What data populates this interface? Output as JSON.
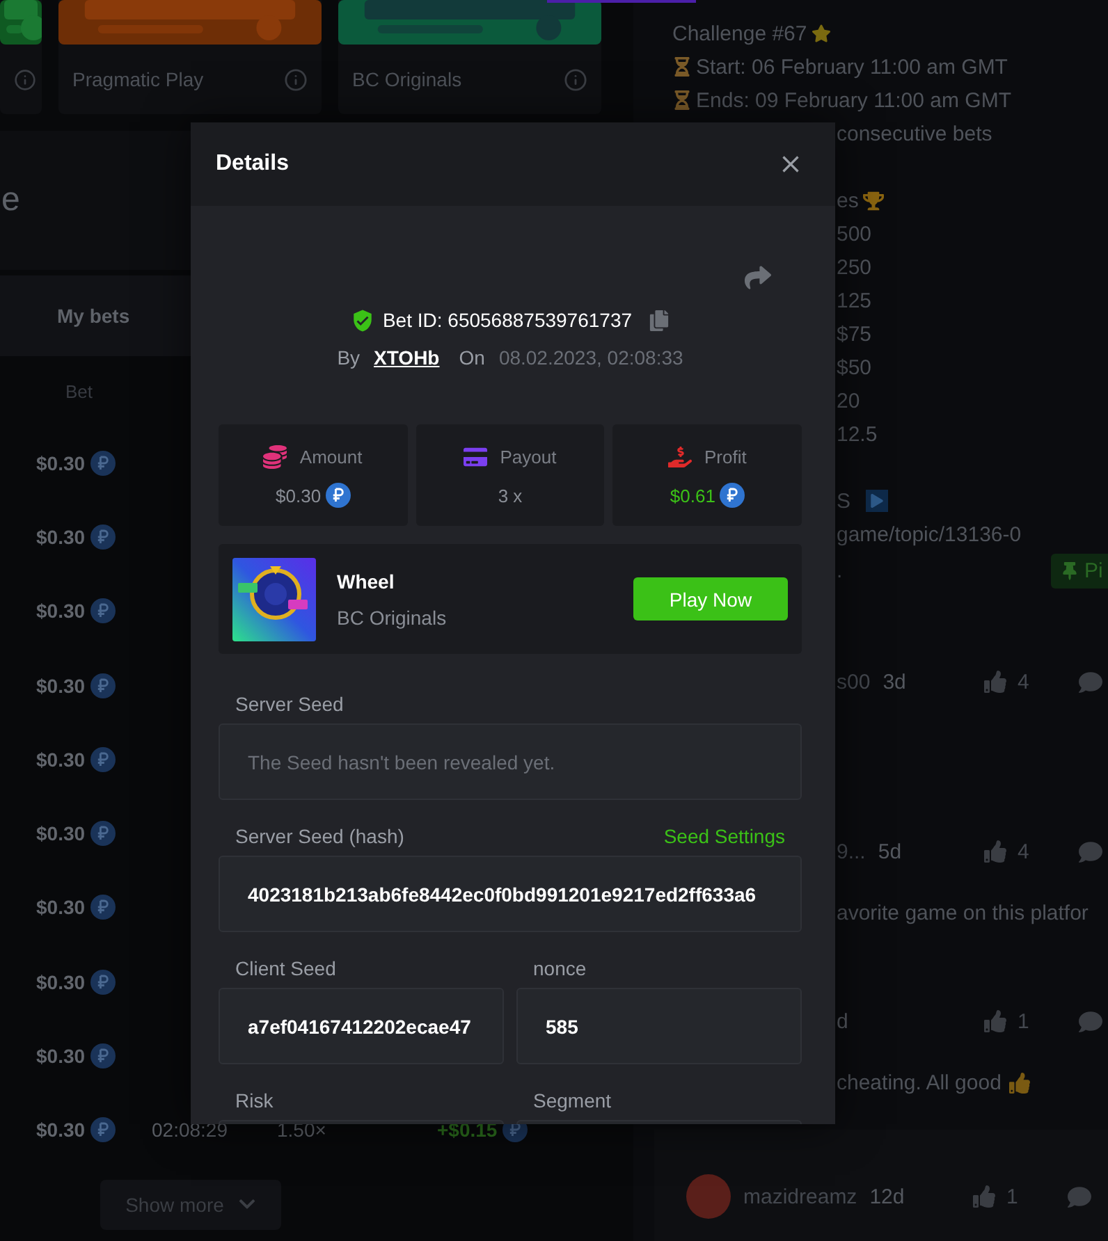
{
  "game_cards": [
    {
      "kind": "partial"
    },
    {
      "kind": "full",
      "provider": "Pragmatic Play"
    },
    {
      "kind": "full",
      "provider": "BC Originals"
    }
  ],
  "heading": "e",
  "tabs": [
    {
      "label": "My bets",
      "selected": true
    }
  ],
  "bets_table": {
    "columns": [
      "Bet"
    ],
    "rows": [
      {
        "bet": "$0.30"
      },
      {
        "bet": "$0.30"
      },
      {
        "bet": "$0.30"
      },
      {
        "bet": "$0.30"
      },
      {
        "bet": "$0.30"
      },
      {
        "bet": "$0.30"
      },
      {
        "bet": "$0.30"
      },
      {
        "bet": "$0.30"
      },
      {
        "bet": "$0.30"
      },
      {
        "bet": "$0.30",
        "time": "02:08:29",
        "payout": "1.50×",
        "profit": "+$0.15"
      }
    ]
  },
  "show_more": "Show more",
  "challenge": [
    {
      "text": "Challenge #67",
      "kind": "line",
      "star": true
    },
    {
      "text": "Start: 06 February 11:00 am GMT",
      "kind": "line",
      "hourglass": true
    },
    {
      "text": "Ends: 09 February 11:00 am GMT",
      "kind": "line",
      "hourglass": true
    },
    {
      "text": "consecutive bets",
      "kind": "tail"
    },
    {
      "text": "es",
      "kind": "tail",
      "spaced": true,
      "trophy": true
    },
    {
      "text": "500",
      "kind": "tail"
    },
    {
      "text": "250",
      "kind": "tail"
    },
    {
      "text": "125",
      "kind": "tail"
    },
    {
      "text": "$75",
      "kind": "tail"
    },
    {
      "text": "$50",
      "kind": "tail"
    },
    {
      "text": "20",
      "kind": "tail"
    },
    {
      "text": "12.5",
      "kind": "tail"
    },
    {
      "text": "S",
      "kind": "tail",
      "spaced": true,
      "play": true
    },
    {
      "text": "game/topic/13136-0",
      "kind": "tail"
    },
    {
      "text": ".",
      "kind": "tail"
    }
  ],
  "pin_button": "Pi",
  "comments": [
    {
      "kind": "tail",
      "author": "s00",
      "time": "3d",
      "likes": "4"
    },
    {
      "kind": "tail",
      "author": "9...",
      "time": "5d",
      "likes": "4",
      "text": "avorite game on this platfor"
    },
    {
      "kind": "tail",
      "time": "d",
      "likes": "1",
      "text": "cheating. All good",
      "thumbs_up": true
    },
    {
      "kind": "card",
      "author": "mazidreamz",
      "time": "12d",
      "likes": "1"
    }
  ],
  "modal": {
    "title": "Details",
    "bet_id": "Bet ID: 65056887539761737",
    "by_label": "By",
    "user": "XTOHb",
    "on_label": "On",
    "date": "08.02.2023, 02:08:33",
    "stats": [
      {
        "kind": "amount",
        "label": "Amount",
        "value": "$0.30",
        "coin": true,
        "positive": false
      },
      {
        "kind": "payout",
        "label": "Payout",
        "value": "3 x",
        "coin": false,
        "positive": false
      },
      {
        "kind": "profit",
        "label": "Profit",
        "value": "$0.61",
        "coin": true,
        "positive": true
      }
    ],
    "game": {
      "name": "Wheel",
      "provider": "BC Originals",
      "action": "Play Now"
    },
    "fields": [
      {
        "kind": "full",
        "label": "Server Seed",
        "placeholder": "The Seed hasn't been revealed yet."
      },
      {
        "kind": "full",
        "label": "Server Seed (hash)",
        "link": "Seed Settings",
        "value": "4023181b213ab6fe8442ec0f0bd991201e9217ed2ff633a6"
      },
      {
        "kind": "half",
        "label": "Client Seed",
        "value": "a7ef04167412202ecae47"
      },
      {
        "kind": "half",
        "label": "nonce",
        "value": "585"
      },
      {
        "kind": "half",
        "label": "Risk"
      },
      {
        "kind": "half",
        "label": "Segment"
      }
    ]
  }
}
